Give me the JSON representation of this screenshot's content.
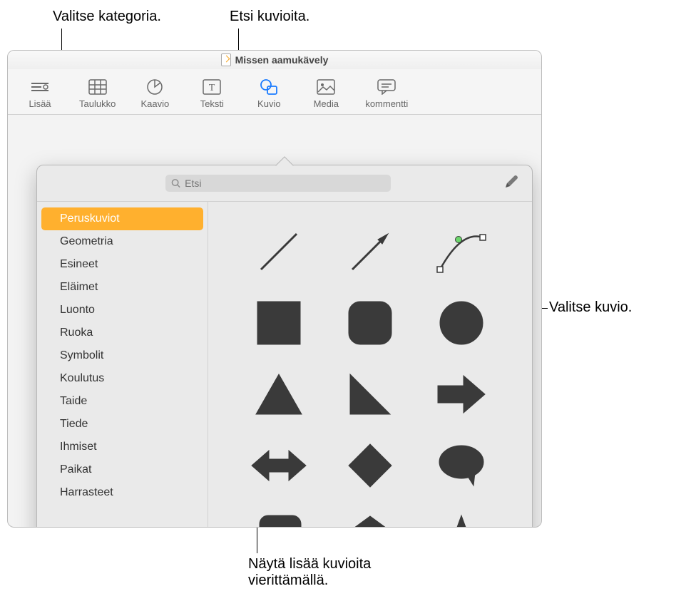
{
  "callouts": {
    "category": "Valitse kategoria.",
    "search": "Etsi kuvioita.",
    "choose_shape": "Valitse kuvio.",
    "scroll_more": "Näytä lisää kuvioita vierittämällä."
  },
  "window": {
    "title": "Missen aamukävely"
  },
  "toolbar": {
    "items": [
      {
        "label": "Lisää",
        "icon": "insert"
      },
      {
        "label": "Taulukko",
        "icon": "table"
      },
      {
        "label": "Kaavio",
        "icon": "chart"
      },
      {
        "label": "Teksti",
        "icon": "text"
      },
      {
        "label": "Kuvio",
        "icon": "shape"
      },
      {
        "label": "Media",
        "icon": "media"
      },
      {
        "label": "kommentti",
        "icon": "comment"
      }
    ],
    "active_index": 4
  },
  "search": {
    "placeholder": "Etsi"
  },
  "sidebar": {
    "items": [
      {
        "label": "Peruskuviot"
      },
      {
        "label": "Geometria"
      },
      {
        "label": "Esineet"
      },
      {
        "label": "Eläimet"
      },
      {
        "label": "Luonto"
      },
      {
        "label": "Ruoka"
      },
      {
        "label": "Symbolit"
      },
      {
        "label": "Koulutus"
      },
      {
        "label": "Taide"
      },
      {
        "label": "Tiede"
      },
      {
        "label": "Ihmiset"
      },
      {
        "label": "Paikat"
      },
      {
        "label": "Harrasteet"
      }
    ],
    "selected_index": 0
  },
  "shapes": [
    {
      "name": "line"
    },
    {
      "name": "arrow-line"
    },
    {
      "name": "curve"
    },
    {
      "name": "square"
    },
    {
      "name": "rounded-square"
    },
    {
      "name": "circle"
    },
    {
      "name": "triangle"
    },
    {
      "name": "right-triangle"
    },
    {
      "name": "arrow-right"
    },
    {
      "name": "arrow-bidirectional"
    },
    {
      "name": "diamond"
    },
    {
      "name": "speech-bubble"
    },
    {
      "name": "callout-box"
    },
    {
      "name": "pentagon"
    },
    {
      "name": "star"
    }
  ]
}
